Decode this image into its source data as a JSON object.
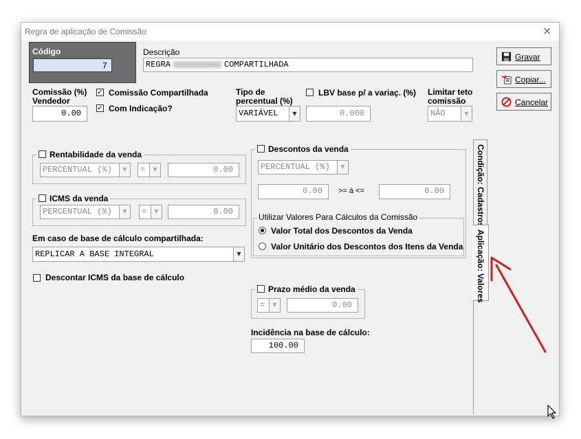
{
  "window": {
    "title": "Regra de aplicação de Comissão",
    "close": "✕"
  },
  "codigo": {
    "label": "Código",
    "value": "7"
  },
  "descricao": {
    "label": "Descrição",
    "value_prefix": "REGRA",
    "value_suffix": "COMPARTILHADA"
  },
  "buttons": {
    "gravar": "Gravar",
    "copiar": "Copiar...",
    "cancelar": "Cancelar"
  },
  "comissao": {
    "label_line1": "Comissão (%)",
    "label_line2": "Vendedor",
    "value": "0.00"
  },
  "compartilhada": {
    "label": "Comissão Compartilhada",
    "checked": true
  },
  "indicacao": {
    "label": "Com Indicação?",
    "checked": true
  },
  "tipo_percentual": {
    "label_line1": "Tipo de",
    "label_line2": "percentual (%)",
    "value": "VARIÁVEL"
  },
  "lbv": {
    "label": "LBV base p/ a variaç. (%)",
    "value": "0.000",
    "checked": false
  },
  "limitar": {
    "label_line1": "Limitar teto",
    "label_line2": "comissão",
    "value": "NÃO"
  },
  "rentabilidade": {
    "label": "Rentabilidade da venda",
    "combo": "PERCENTUAL (%)",
    "op": "=",
    "value": "0.00"
  },
  "icms": {
    "label": "ICMS da venda",
    "combo": "PERCENTUAL (%)",
    "op": "=",
    "value": "0.00"
  },
  "base_compartilhada": {
    "label": "Em caso de base de cálculo compartilhada:",
    "value": "REPLICAR A BASE INTEGRAL"
  },
  "descontar_icms": {
    "label": "Descontar ICMS da base de cálculo"
  },
  "descontos": {
    "label": "Descontos da venda",
    "combo": "PERCENTUAL (%)",
    "min": "0.00",
    "range_label": ">= à <=",
    "max": "0.00",
    "utilizar_label": "Utilizar Valores Para Cálculos da Comissão",
    "opt_total": "Valor Total dos Descontos da Venda",
    "opt_unitario": "Valor Unitário dos Descontos dos Itens da Venda"
  },
  "prazo": {
    "label": "Prazo médio da venda",
    "op": "=",
    "value": "0.00"
  },
  "incidencia": {
    "label": "Incidência na base de cálculo:",
    "value": "100.00"
  },
  "tabs": {
    "cadastros": "Condição: Cadastros",
    "valores": "Aplicação: Valores"
  },
  "colors": {
    "arrow": "#cc2222",
    "codigo_panel": "#6d6d6d",
    "codigo_input": "#d6e4f5"
  },
  "icons": [
    "floppy-disk-icon",
    "copy-icon",
    "cancel-icon",
    "close-icon",
    "mouse-cursor-icon",
    "annotation-arrow"
  ]
}
